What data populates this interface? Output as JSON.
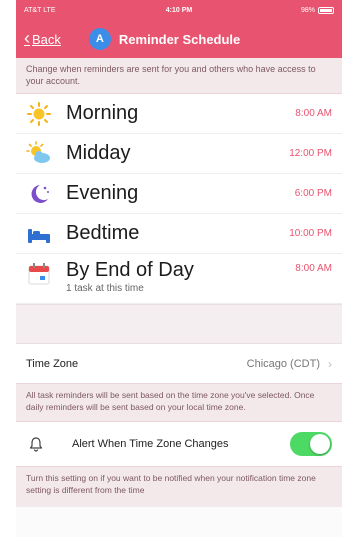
{
  "status_bar": {
    "carrier": "AT&T LTE",
    "time": "4:10 PM",
    "battery": "98%"
  },
  "nav": {
    "back_label": "Back",
    "avatar_letter": "A",
    "title": "Reminder Schedule"
  },
  "intro_text": "Change when reminders are sent for you and others who have access to your account.",
  "reminders": [
    {
      "label": "Morning",
      "time": "8:00 AM",
      "icon": "sun-icon"
    },
    {
      "label": "Midday",
      "time": "12:00 PM",
      "icon": "partly-cloudy-icon"
    },
    {
      "label": "Evening",
      "time": "6:00 PM",
      "icon": "moon-stars-icon"
    },
    {
      "label": "Bedtime",
      "time": "10:00 PM",
      "icon": "bed-icon"
    },
    {
      "label": "By End of Day",
      "time": "8:00 AM",
      "sub": "1 task at this time",
      "icon": "calendar-icon"
    }
  ],
  "timezone": {
    "label": "Time Zone",
    "value": "Chicago (CDT)"
  },
  "timezone_note": "All task reminders will be sent based on the time zone you've selected. Once daily reminders will be sent based on your local time zone.",
  "alert": {
    "label": "Alert When Time Zone Changes",
    "enabled": true
  },
  "alert_note": "Turn this setting on if you want to be notified when your notification time zone setting is different from the time",
  "colors": {
    "brand": "#e8536f",
    "toggle_on": "#4cd964"
  }
}
